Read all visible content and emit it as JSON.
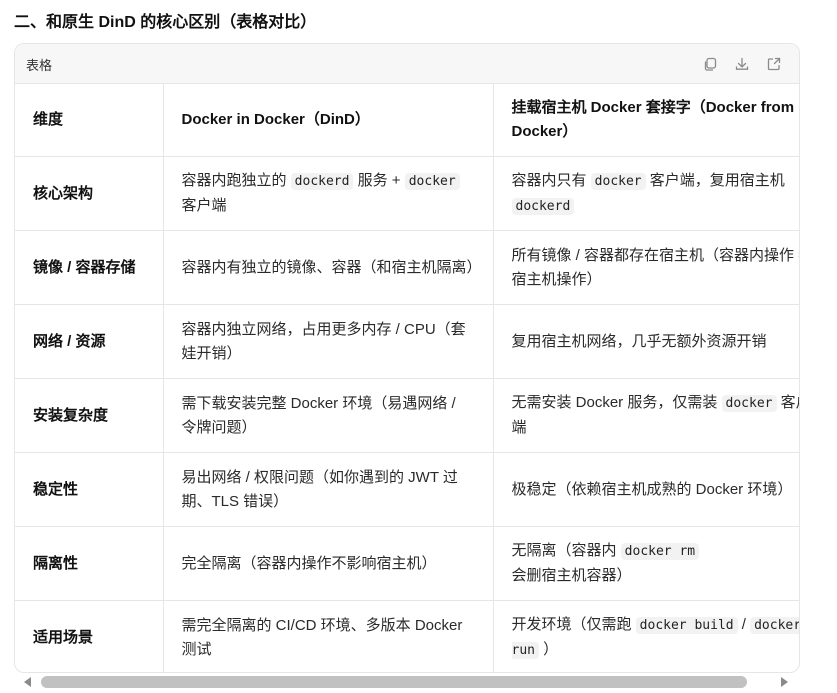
{
  "section_title": "二、和原生 DinD 的核心区别（表格对比）",
  "table_card": {
    "label": "表格",
    "actions": [
      {
        "name": "copy-icon"
      },
      {
        "name": "download-icon"
      },
      {
        "name": "expand-icon"
      }
    ]
  },
  "table": {
    "headers": [
      "维度",
      "Docker in Docker（DinD）",
      "挂载宿主机 Docker 套接字（Docker from Docker）"
    ],
    "rows": [
      {
        "dimension": "核心架构",
        "dind": [
          {
            "t": "text",
            "v": "容器内跑独立的 "
          },
          {
            "t": "code",
            "v": "dockerd"
          },
          {
            "t": "text",
            "v": " 服务 + "
          },
          {
            "t": "code",
            "v": "docker"
          },
          {
            "t": "text",
            "v": " 客户端"
          }
        ],
        "host": [
          {
            "t": "text",
            "v": "容器内只有 "
          },
          {
            "t": "code",
            "v": "docker"
          },
          {
            "t": "text",
            "v": " 客户端，复用宿主机 "
          },
          {
            "t": "code",
            "v": "dockerd"
          }
        ]
      },
      {
        "dimension": "镜像 / 容器存储",
        "dind": [
          {
            "t": "text",
            "v": "容器内有独立的镜像、容器（和宿主机隔离）"
          }
        ],
        "host": [
          {
            "t": "text",
            "v": "所有镜像 / 容器都存在宿主机（容器内操作 = 宿主机操作）"
          }
        ]
      },
      {
        "dimension": "网络 / 资源",
        "dind": [
          {
            "t": "text",
            "v": "容器内独立网络，占用更多内存 / CPU（套娃开销）"
          }
        ],
        "host": [
          {
            "t": "text",
            "v": "复用宿主机网络，几乎无额外资源开销"
          }
        ]
      },
      {
        "dimension": "安装复杂度",
        "dind": [
          {
            "t": "text",
            "v": "需下载安装完整 Docker 环境（易遇网络 / 令牌问题）"
          }
        ],
        "host": [
          {
            "t": "text",
            "v": "无需安装 Docker 服务，仅需装 "
          },
          {
            "t": "code",
            "v": "docker"
          },
          {
            "t": "text",
            "v": " 客户端"
          }
        ]
      },
      {
        "dimension": "稳定性",
        "dind": [
          {
            "t": "text",
            "v": "易出网络 / 权限问题（如你遇到的 JWT 过期、TLS 错误）"
          }
        ],
        "host": [
          {
            "t": "text",
            "v": "极稳定（依赖宿主机成熟的 Docker 环境）"
          }
        ]
      },
      {
        "dimension": "隔离性",
        "dind": [
          {
            "t": "text",
            "v": "完全隔离（容器内操作不影响宿主机）"
          }
        ],
        "host": [
          {
            "t": "text",
            "v": "无隔离（容器内 "
          },
          {
            "t": "code",
            "v": "docker rm"
          },
          {
            "t": "text",
            "v": " 会删宿主机容器）"
          }
        ]
      },
      {
        "dimension": "适用场景",
        "dind": [
          {
            "t": "text",
            "v": "需完全隔离的 CI/CD 环境、多版本 Docker 测试"
          }
        ],
        "host": [
          {
            "t": "text",
            "v": "开发环境（仅需跑 "
          },
          {
            "t": "code",
            "v": "docker build"
          },
          {
            "t": "text",
            "v": " / "
          },
          {
            "t": "code",
            "v": "docker run"
          },
          {
            "t": "text",
            "v": " ）"
          }
        ]
      }
    ]
  },
  "scrollbar": {
    "horizontal": true
  }
}
